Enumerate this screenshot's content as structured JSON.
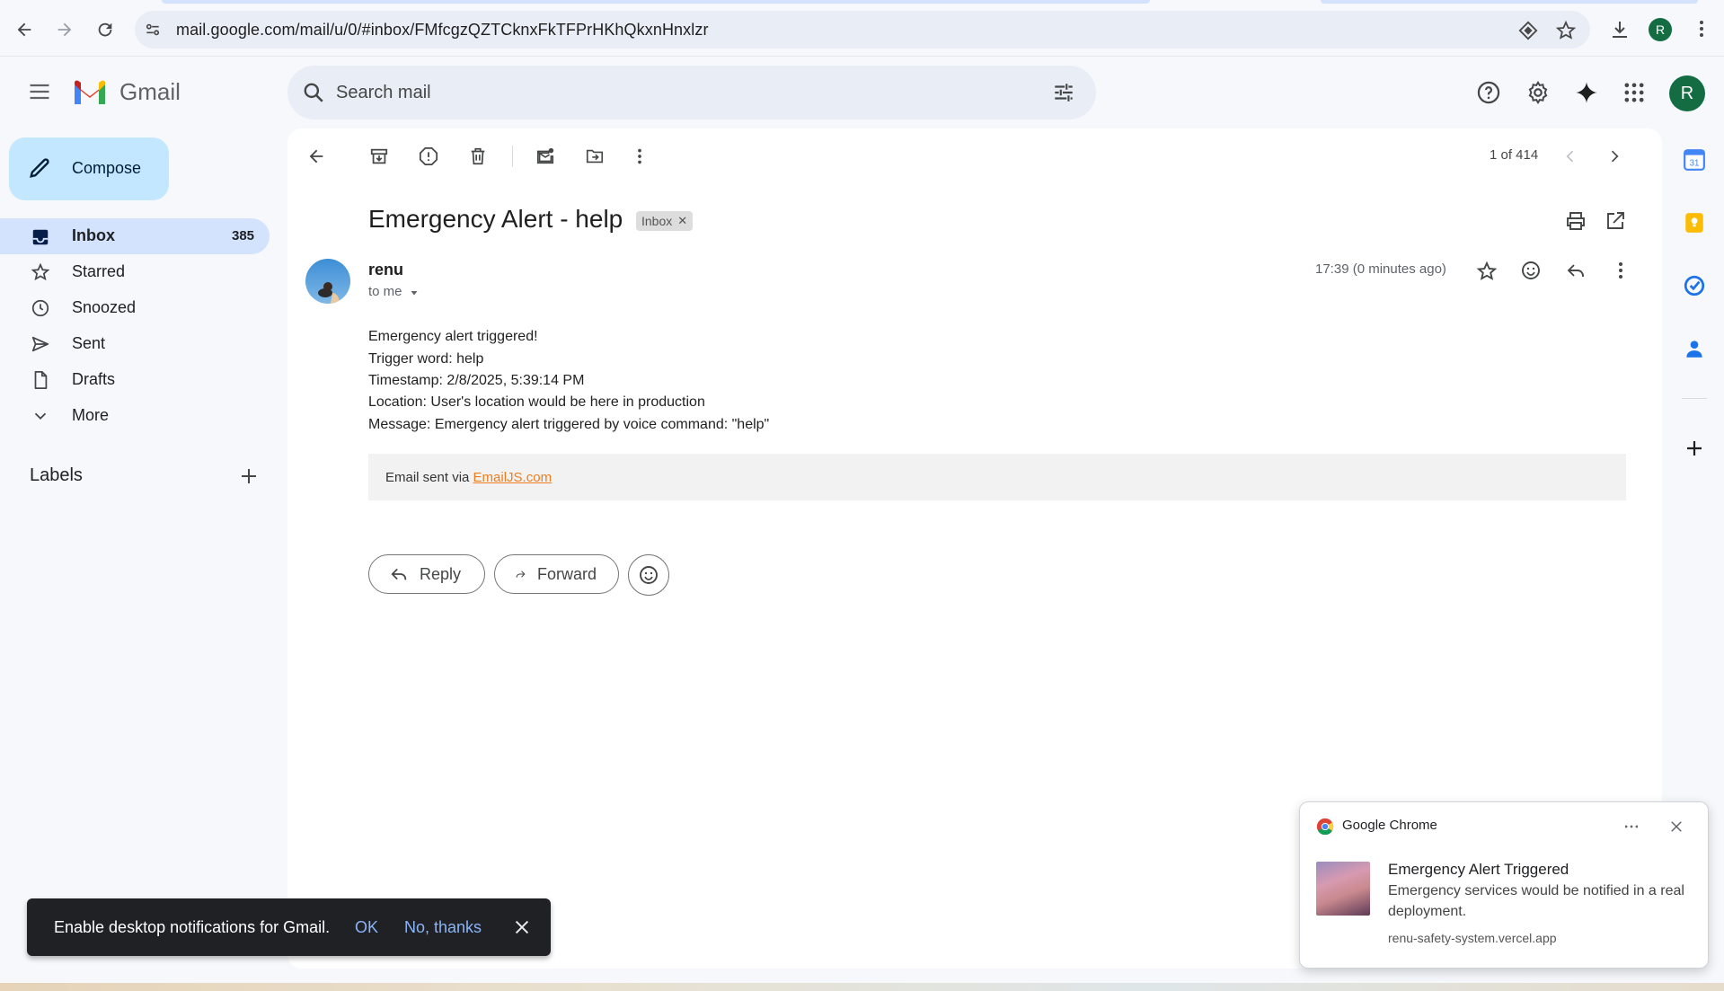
{
  "browser": {
    "url": "mail.google.com/mail/u/0/#inbox/FMfcgzQZTCknxFkTFPrHKhQkxnHnxlzr",
    "profile_initial": "R"
  },
  "header": {
    "product_name": "Gmail",
    "search_placeholder": "Search mail",
    "avatar_initial": "R"
  },
  "sidebar": {
    "compose_label": "Compose",
    "items": [
      {
        "label": "Inbox",
        "count": "385"
      },
      {
        "label": "Starred"
      },
      {
        "label": "Snoozed"
      },
      {
        "label": "Sent"
      },
      {
        "label": "Drafts"
      },
      {
        "label": "More"
      }
    ],
    "labels_title": "Labels"
  },
  "toolbar": {
    "pagination": "1 of 414"
  },
  "message": {
    "subject": "Emergency Alert - help",
    "label_chip": "Inbox",
    "sender": "renu",
    "recipient": "to me",
    "time": "17:39 (0 minutes ago)",
    "body_lines": [
      "Emergency alert triggered!",
      "Trigger word: help",
      "Timestamp: 2/8/2025, 5:39:14 PM",
      "Location: User's location would be here in production",
      "Message: Emergency alert triggered by voice command: \"help\""
    ],
    "footer_prefix": "Email sent via ",
    "footer_link": "EmailJS.com",
    "reply_label": "Reply",
    "forward_label": "Forward"
  },
  "snackbar": {
    "text": "Enable desktop notifications for Gmail.",
    "ok": "OK",
    "no": "No, thanks"
  },
  "notification": {
    "app": "Google Chrome",
    "title": "Emergency Alert Triggered",
    "body": "Emergency services would be notified in a real deployment.",
    "origin": "renu-safety-system.vercel.app"
  },
  "colors": {
    "accent": "#0b57d0",
    "compose_bg": "#c2e7ff",
    "active_nav_bg": "#d3e3fd",
    "link_orange": "#f07d1c",
    "avatar_green": "#146c43"
  }
}
